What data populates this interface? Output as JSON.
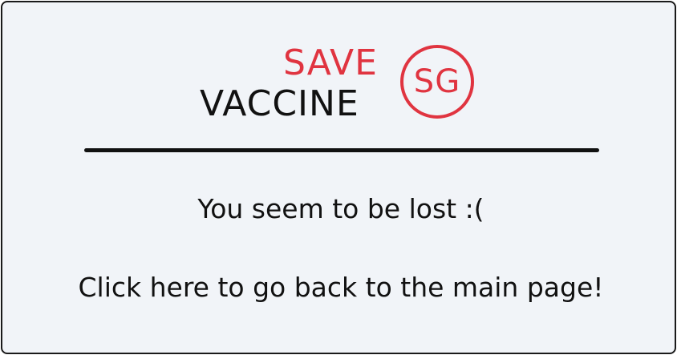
{
  "logo": {
    "top_text": "SAVE",
    "bottom_text": "VACCINE",
    "badge_text": "SG",
    "accent_color": "#e03440",
    "text_color": "#111111"
  },
  "message": {
    "lost_text": "You seem to be lost :(",
    "link_text": "Click here to go back to the main page!"
  },
  "colors": {
    "background": "#f1f4f8",
    "border": "#1a1a1a"
  }
}
